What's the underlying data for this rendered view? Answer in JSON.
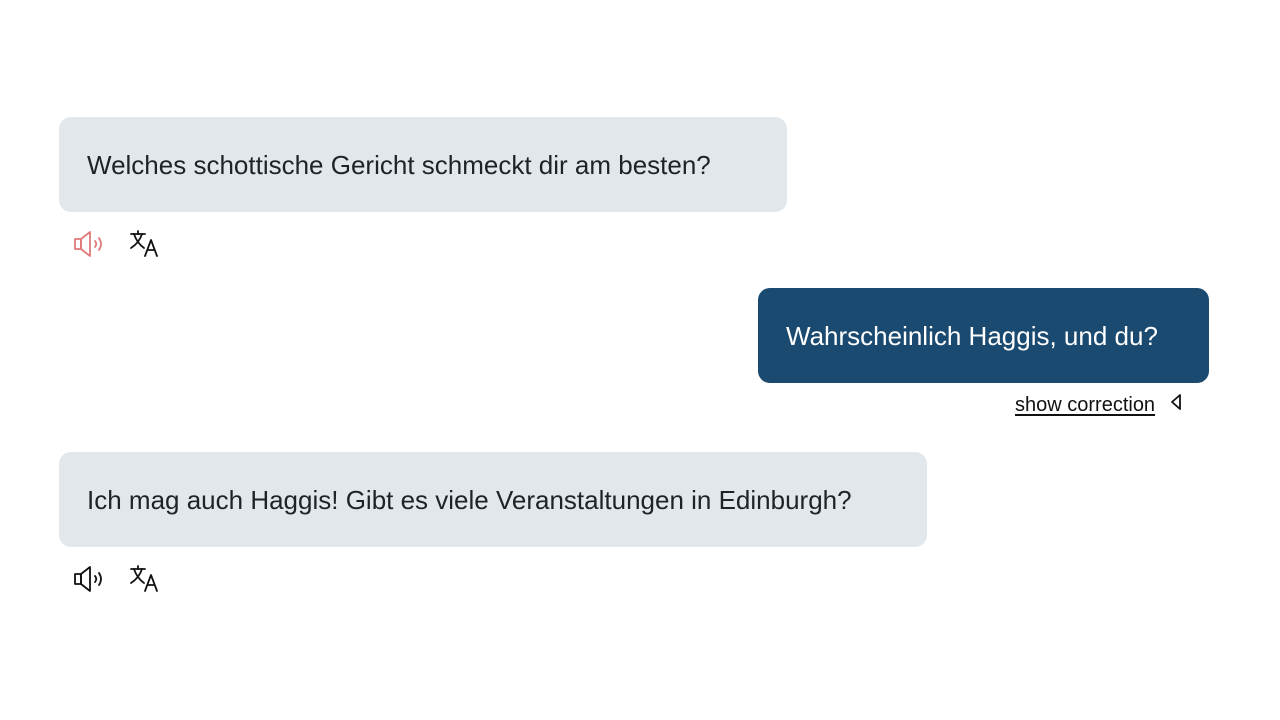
{
  "messages": [
    {
      "role": "bot",
      "text": "Welches schottische Gericht schmeckt dir am besten?",
      "speaker_icon": "speaker-icon",
      "speaker_color": "#e07a7a",
      "translate_icon": "translate-icon"
    },
    {
      "role": "user",
      "text": "Wahrscheinlich Haggis, und du?",
      "correction_label": "show correction",
      "correction_icon": "caret-left-icon"
    },
    {
      "role": "bot",
      "text": "Ich mag auch Haggis! Gibt es viele Veranstaltungen in Edinburgh?",
      "speaker_icon": "speaker-icon",
      "speaker_color": "#111111",
      "translate_icon": "translate-icon"
    }
  ],
  "colors": {
    "bot_bubble": "#e2e7ec",
    "user_bubble": "#1a4a70",
    "speaker_active": "#e07a7a"
  }
}
